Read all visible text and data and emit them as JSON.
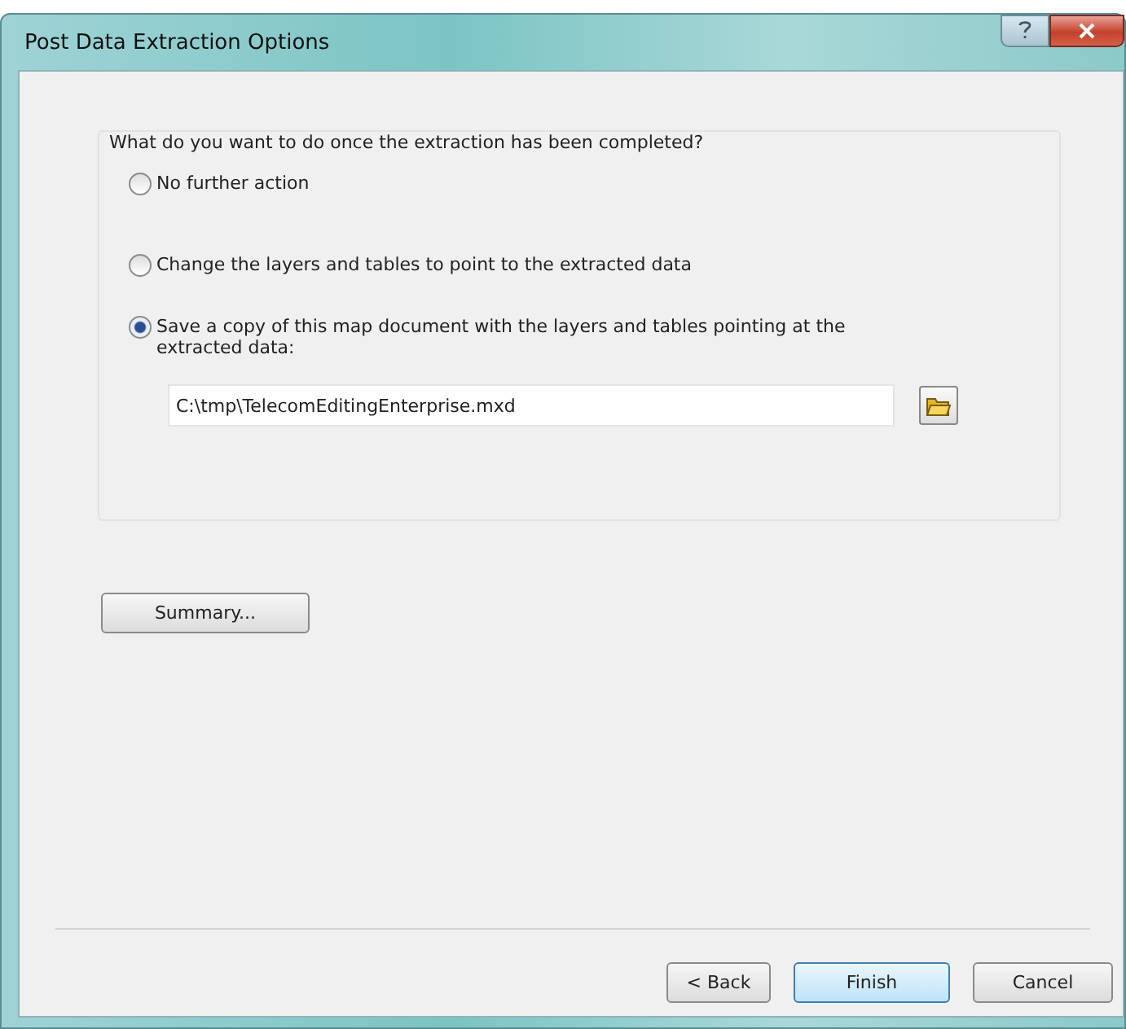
{
  "window": {
    "title": "Post Data Extraction Options"
  },
  "question": "What do you want to do once the extraction has been completed?",
  "options": [
    {
      "label": "No further action",
      "selected": false
    },
    {
      "label": "Change the layers and tables to point to the extracted data",
      "selected": false
    },
    {
      "label": "Save a copy of this map document with the layers and tables pointing at the extracted data:",
      "selected": true
    }
  ],
  "path_field": {
    "value": "C:\\tmp\\TelecomEditingEnterprise.mxd"
  },
  "summary_button": "Summary...",
  "buttons": [
    {
      "label": "< Back",
      "kind": "normal"
    },
    {
      "label": "Finish",
      "kind": "default"
    },
    {
      "label": "Cancel",
      "kind": "normal"
    }
  ]
}
